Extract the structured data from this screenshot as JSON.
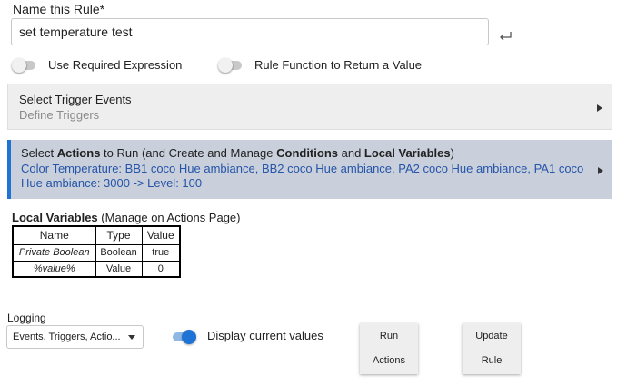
{
  "rule_name": {
    "label": "Name this Rule*",
    "value": "set temperature test"
  },
  "toggles": {
    "required_expression": {
      "label": "Use Required Expression",
      "on": false
    },
    "rule_function": {
      "label": "Rule Function to Return a Value",
      "on": false
    },
    "display_values": {
      "label": "Display current values",
      "on": true
    }
  },
  "trigger_panel": {
    "title": "Select Trigger Events",
    "subtitle": "Define Triggers"
  },
  "actions_panel": {
    "title_parts": [
      "Select ",
      "Actions",
      " to Run (and Create and Manage ",
      "Conditions",
      " and ",
      "Local Variables",
      ")"
    ],
    "subtitle": "Color Temperature: BB1 coco Hue ambiance, BB2 coco Hue ambiance, PA2 coco Hue ambiance, PA1 coco Hue ambiance: 3000 -> Level: 100"
  },
  "local_variables": {
    "title_bold": "Local Variables",
    "title_rest": " (Manage on Actions Page)",
    "headers": [
      "Name",
      "Type",
      "Value"
    ],
    "rows": [
      [
        "Private Boolean",
        "Boolean",
        "true"
      ],
      [
        "%value%",
        "Value",
        "0"
      ]
    ]
  },
  "logging": {
    "label": "Logging",
    "selected": "Events, Triggers, Actio..."
  },
  "buttons": {
    "run_actions": [
      "Run",
      "Actions"
    ],
    "update_rule": [
      "Update",
      "Rule"
    ]
  },
  "colors": {
    "accent": "#1e73d4",
    "actions_panel_bg": "#c9d0dc",
    "actions_text": "#2554a8",
    "trigger_panel_bg": "#eeeeee"
  },
  "icons": {
    "enter": "return-enter-icon",
    "panel_caret": "caret-right-icon",
    "select_caret": "caret-down-icon"
  }
}
